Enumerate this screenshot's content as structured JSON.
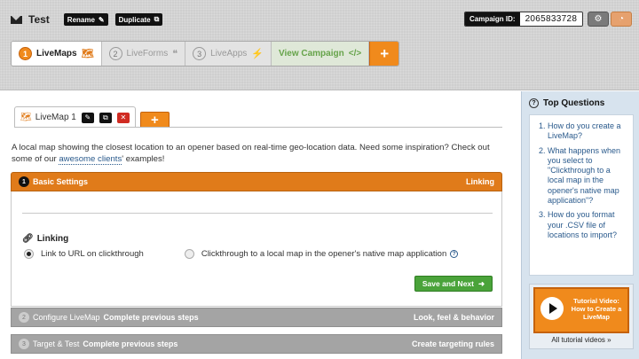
{
  "header": {
    "title": "Test",
    "rename_label": "Rename",
    "duplicate_label": "Duplicate",
    "campaign_id_label": "Campaign ID:",
    "campaign_id_value": "2065833728"
  },
  "main_tabs": [
    {
      "num": "1",
      "label": "LiveMaps"
    },
    {
      "num": "2",
      "label": "LiveForms"
    },
    {
      "num": "3",
      "label": "LiveApps"
    }
  ],
  "view_campaign_label": "View Campaign",
  "view_campaign_icon": "</>",
  "plus_label": "+",
  "sub_tab": {
    "label": "LiveMap 1"
  },
  "description": {
    "text1": "A local map showing the closest location to an opener based on real-time geo-location data. Need some inspiration? Check out some of our ",
    "link": "awesome clients",
    "text2": "' examples!"
  },
  "basic_settings": {
    "num": "1",
    "title": "Basic Settings",
    "right": "Linking"
  },
  "linking": {
    "title": "Linking",
    "option1": "Link to URL on clickthrough",
    "option2": "Clickthrough to a local map in the opener's native map application",
    "help": "?"
  },
  "save_next_label": "Save and Next",
  "config_section": {
    "num": "2",
    "title": "Configure LiveMap",
    "status": "Complete previous steps",
    "right": "Look, feel & behavior"
  },
  "target_section": {
    "num": "3",
    "title": "Target & Test",
    "status": "Complete previous steps",
    "right": "Create targeting rules"
  },
  "sidebar": {
    "title": "Top Questions",
    "questions": [
      "How do you create a LiveMap?",
      "What happens when you select to \"Clickthrough to a local map in the opener's native map application\"?",
      "How do you format your .CSV file of locations to import?"
    ],
    "tutorial_text": "Tutorial Video: How to Create a LiveMap",
    "all_videos": "All tutorial videos »"
  },
  "icons": {
    "mail": "mail-icon",
    "pencil": "pencil-icon",
    "copy": "copy-icon",
    "map": "map-icon",
    "quote": "quote-icon",
    "plug": "plug-icon",
    "gear": "gear-icon",
    "rss": "rss-icon",
    "close": "close-icon",
    "link": "link-icon",
    "arrow": "arrow-right-icon",
    "play": "play-icon"
  },
  "colors": {
    "accent": "#f08a1c",
    "green": "#4aa33a",
    "link": "#2a5a8c",
    "grey_section": "#a4a4a4"
  }
}
